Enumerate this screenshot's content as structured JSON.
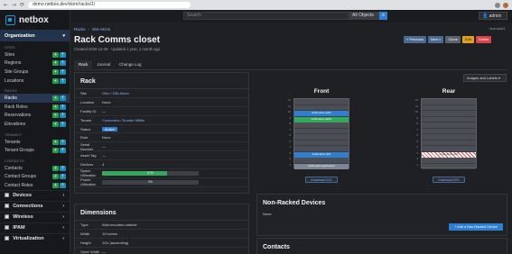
{
  "browser": {
    "url": "demo.netbox.dev/dcim/racks/1/",
    "back": "←",
    "forward": "→",
    "reload": "⟳"
  },
  "app": {
    "logo_text": "netbox"
  },
  "sidebar": {
    "org_header": "Organization",
    "groups": [
      {
        "label": "Sites",
        "items": [
          "Sites",
          "Regions",
          "Site Groups",
          "Locations"
        ]
      },
      {
        "label": "Racks",
        "items": [
          "Racks",
          "Rack Roles",
          "Reservations",
          "Elevations"
        ]
      },
      {
        "label": "Tenancy",
        "items": [
          "Tenants",
          "Tenant Groups"
        ]
      },
      {
        "label": "Contacts",
        "items": [
          "Contacts",
          "Contact Groups",
          "Contact Roles"
        ]
      }
    ],
    "active_item": "Racks",
    "sections": [
      "Devices",
      "Connections",
      "Wireless",
      "IPAM",
      "Virtualization"
    ]
  },
  "topbar": {
    "search_placeholder": "Search",
    "object_filter": "All Objects",
    "user": "admin"
  },
  "header": {
    "breadcrumb": [
      "Racks",
      "DM-Akron"
    ],
    "title": "Rack Comms closet",
    "meta": "Created 2020-12-28 · Updated 1 year, 1 month ago",
    "top_right_note": "rack:rack/1",
    "actions": {
      "previous": "« Previous",
      "next": "Next »",
      "clone": "Clone",
      "edit": "Edit",
      "delete": "Delete"
    }
  },
  "tabs": [
    "Rack",
    "Journal",
    "Change Log"
  ],
  "rack_card": {
    "title": "Rack",
    "rows": [
      {
        "key": "Site",
        "value": "Ohio / DM-Akron",
        "link": true
      },
      {
        "key": "Location",
        "value": "None"
      },
      {
        "key": "Facility ID",
        "value": "—"
      },
      {
        "key": "Tenant",
        "value": "Customers / Dunder Mifflin",
        "link": true
      },
      {
        "key": "Status",
        "value": "Active",
        "badge": true
      },
      {
        "key": "Role",
        "value": "None"
      },
      {
        "key": "Serial Number",
        "value": "—"
      },
      {
        "key": "Asset Tag",
        "value": "—"
      },
      {
        "key": "Devices",
        "value": "4"
      },
      {
        "key": "Space Utilization",
        "value": "67%",
        "bar": 0.67
      },
      {
        "key": "Power Utilization",
        "value": "0%",
        "bar": 0.0
      }
    ]
  },
  "dimensions_card": {
    "title": "Dimensions",
    "rows": [
      {
        "key": "Type",
        "value": "Wall-mounted cabinet"
      },
      {
        "key": "Width",
        "value": "19 inches"
      },
      {
        "key": "Height",
        "value": "12U (ascending)"
      },
      {
        "key": "Outer Width",
        "value": "—"
      }
    ]
  },
  "elevations": {
    "image_select": "Images and Labels",
    "front": {
      "title": "Front",
      "devices": [
        {
          "label": "dmi01-akron-patch-panel",
          "unit": 1,
          "span": 1,
          "color": "#7d8694"
        },
        {
          "label": "dmi01-akron-rtr01",
          "unit": 3,
          "span": 1,
          "color": "#2f7fd1"
        },
        {
          "label": "dmi01-akron-pdu01",
          "unit": 9,
          "span": 1,
          "color": "#37a85b"
        },
        {
          "label": "dmi01-akron-sw01",
          "unit": 10,
          "span": 1,
          "color": "#2f7fd1"
        }
      ]
    },
    "rear": {
      "title": "Rear",
      "devices": [
        {
          "label": "dmi01-akron-rtr01",
          "unit": 3,
          "span": 1,
          "hatched": true
        }
      ]
    },
    "unit_labels": [
      "12",
      "11",
      "10",
      "9",
      "8",
      "7",
      "6",
      "5",
      "4",
      "3",
      "2",
      "1"
    ],
    "download_label": "Download SVG"
  },
  "non_racked": {
    "title": "Non-Racked Devices",
    "value": "None",
    "add_button": "+ Add a Non-Racked Device"
  },
  "contacts": {
    "title": "Contacts"
  }
}
